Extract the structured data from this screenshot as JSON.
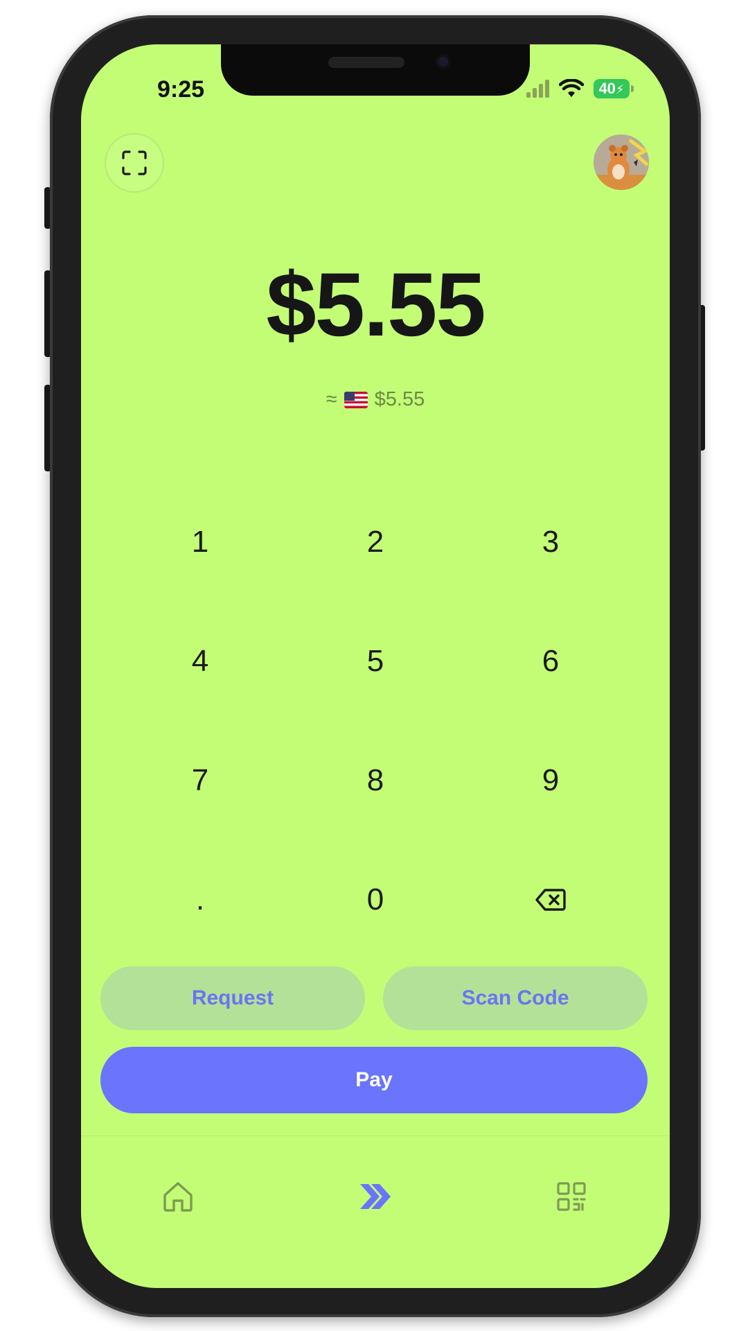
{
  "status_bar": {
    "time": "9:25",
    "battery_percent": "40"
  },
  "header": {
    "scan_icon": "scan-frame-icon",
    "avatar": "profile-avatar"
  },
  "amount": {
    "value": "$5.55",
    "approx_symbol": "≈",
    "flag": "us-flag-icon",
    "converted_value": "$5.55"
  },
  "keypad": {
    "keys": [
      "1",
      "2",
      "3",
      "4",
      "5",
      "6",
      "7",
      "8",
      "9",
      ".",
      "0"
    ],
    "backspace_icon": "backspace-icon"
  },
  "actions": {
    "request_label": "Request",
    "scan_code_label": "Scan Code",
    "pay_label": "Pay"
  },
  "nav": {
    "items": [
      "home-icon",
      "send-chevrons-icon",
      "qr-code-icon"
    ],
    "active": "send-chevrons-icon"
  },
  "colors": {
    "background": "#c3fd76",
    "accent": "#6a74fc",
    "secondary_button": "#b3e197"
  }
}
